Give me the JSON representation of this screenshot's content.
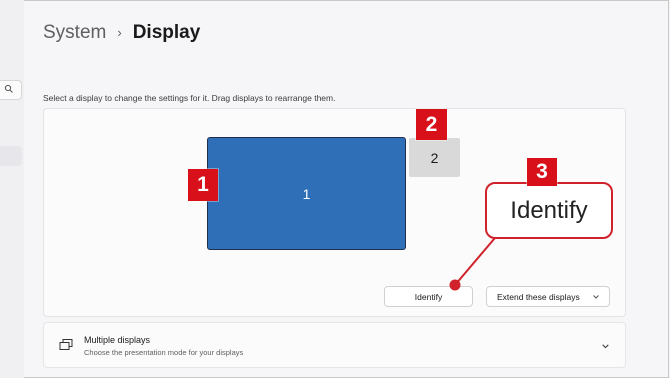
{
  "breadcrumb": {
    "parent": "System",
    "separator": "›",
    "current": "Display"
  },
  "instruction": "Select a display to change the settings for it. Drag displays to rearrange them.",
  "displays": [
    {
      "label": "1",
      "color": "#2f6fb8"
    },
    {
      "label": "2",
      "color": "#d9d9d9"
    }
  ],
  "buttons": {
    "identify": "Identify",
    "extend": "Extend these displays"
  },
  "multiple_displays": {
    "title": "Multiple displays",
    "subtitle": "Choose the presentation mode for your displays"
  },
  "callouts": {
    "n1": "1",
    "n2": "2",
    "n3": "3",
    "zoom_text": "Identify",
    "accent": "#d8101a"
  },
  "icons": {
    "search": "search-icon",
    "extend_chevron": "chevron-down-icon",
    "multi": "multiple-displays-icon",
    "multi_chevron": "chevron-down-icon"
  }
}
